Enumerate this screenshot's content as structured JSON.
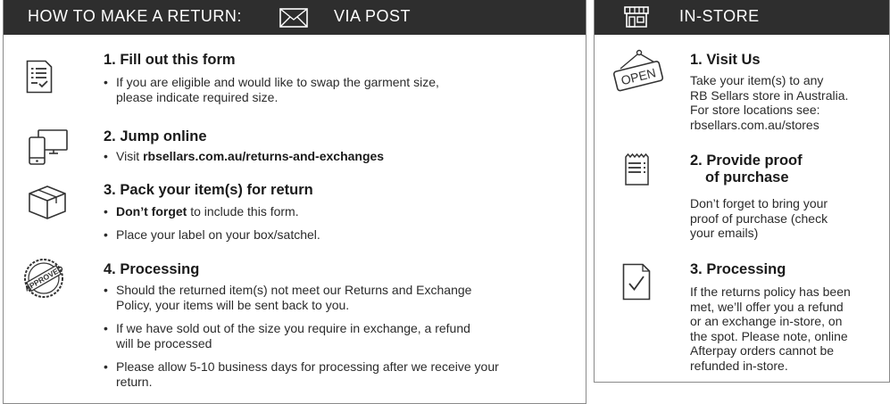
{
  "post": {
    "header": {
      "title": "HOW TO MAKE A RETURN:",
      "via": "VIA POST",
      "icon": "envelope-icon"
    },
    "steps": [
      {
        "title": "1. Fill out this form",
        "icon": "form-checklist-icon",
        "bullets": [
          {
            "lines": [
              "If you are eligible and would like to swap the garment size,",
              "please indicate required size."
            ]
          }
        ]
      },
      {
        "title": "2. Jump online",
        "icon": "devices-icon",
        "bullets": [
          {
            "prefix": "Visit ",
            "bold": "rbsellars.com.au/returns-and-exchanges"
          }
        ]
      },
      {
        "title": "3. Pack your item(s) for return",
        "icon": "box-icon",
        "bullets": [
          {
            "bold": "Don’t forget",
            "suffix": " to include this form."
          },
          {
            "lines": [
              "Place your label on your box/satchel."
            ]
          }
        ]
      },
      {
        "title": "4. Processing",
        "icon": "approved-stamp-icon",
        "stamp_text": "APPROVED",
        "bullets": [
          {
            "lines": [
              "Should the returned item(s) not meet our Returns and Exchange",
              "Policy, your items will be sent back to you."
            ]
          },
          {
            "lines": [
              "If we have sold out of the size you require in exchange, a refund",
              "will be processed"
            ]
          },
          {
            "lines": [
              "Please allow 5-10 business days for processing after we receive your",
              "return."
            ]
          }
        ]
      }
    ]
  },
  "store": {
    "header": {
      "title": "IN-STORE",
      "icon": "storefront-icon"
    },
    "steps": [
      {
        "title_lines": [
          "1. Visit Us"
        ],
        "icon": "open-sign-icon",
        "sign_text": "OPEN",
        "lines": [
          "Take your item(s) to any",
          "RB Sellars store in Australia.",
          "For store locations see:",
          "rbsellars.com.au/stores"
        ]
      },
      {
        "title_lines": [
          "2. Provide proof",
          "of purchase"
        ],
        "icon": "receipt-icon",
        "lines": [
          "Don’t forget to bring your",
          "proof of purchase (check",
          "your emails)"
        ]
      },
      {
        "title_lines": [
          "3. Processing"
        ],
        "icon": "document-check-icon",
        "lines": [
          "If the returns policy has been",
          "met, we’ll offer you a refund",
          "or an exchange in-store, on",
          "the spot. Please note, online",
          "Afterpay orders cannot be",
          "refunded in-store."
        ]
      }
    ]
  },
  "bullet_char": "•"
}
